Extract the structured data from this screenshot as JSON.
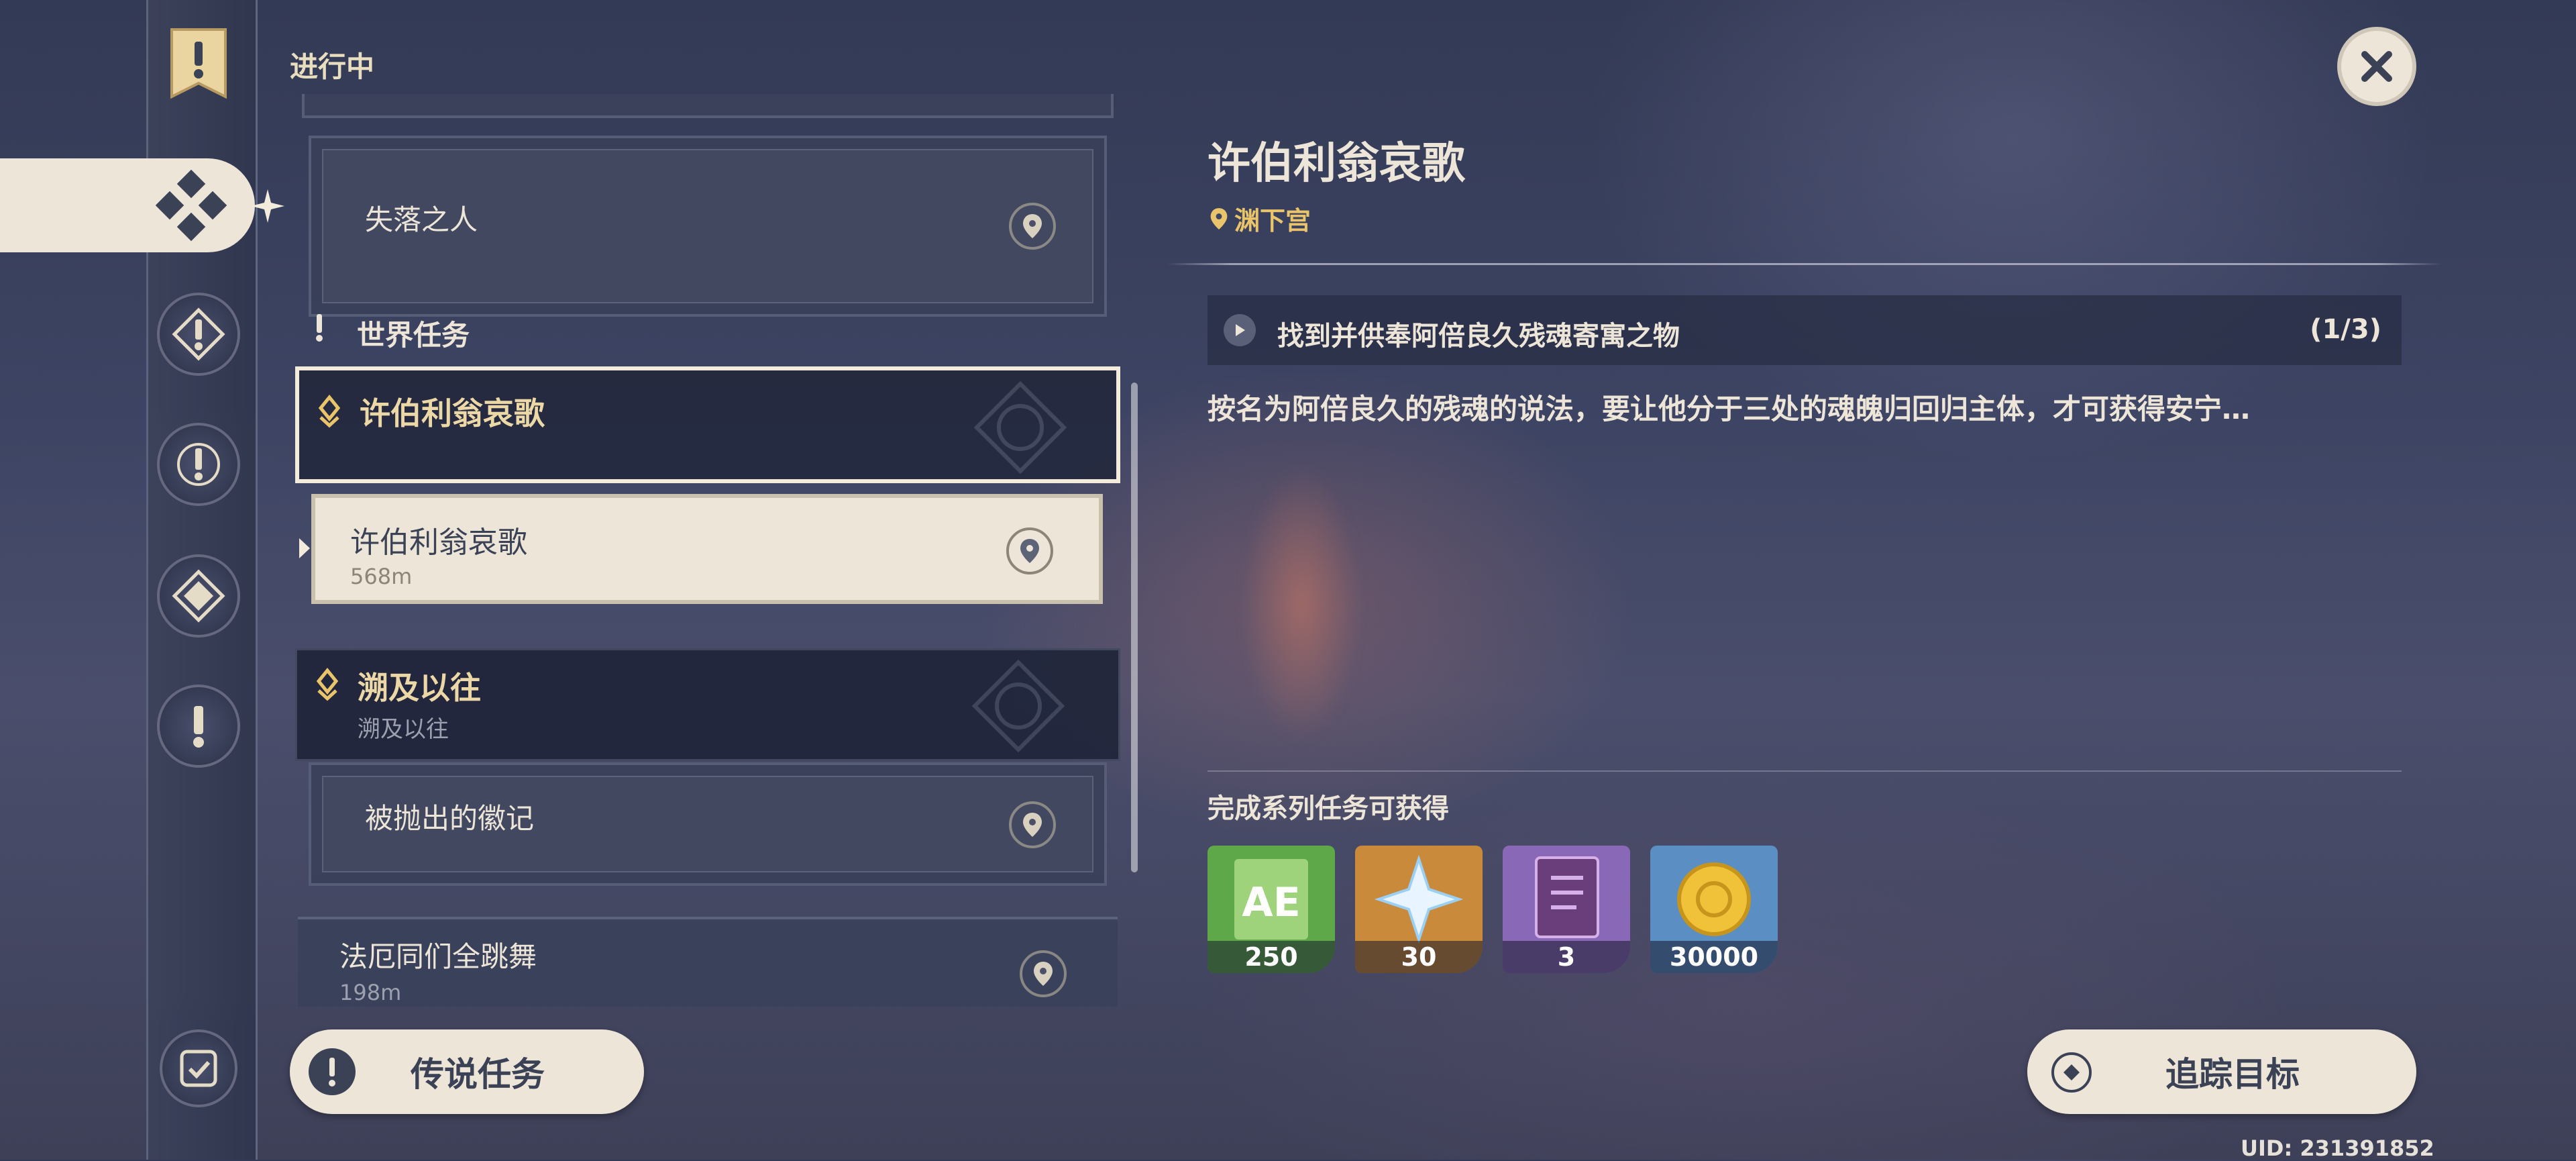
{
  "header": {
    "tab_label": "进行中"
  },
  "rail": {
    "items": [
      {
        "name": "all-quests",
        "active": true
      },
      {
        "name": "archon-quests"
      },
      {
        "name": "story-quests"
      },
      {
        "name": "commissions"
      },
      {
        "name": "world-quests"
      },
      {
        "name": "quest-log-settings"
      }
    ]
  },
  "quest_list": {
    "items": [
      {
        "title": "失落之人"
      },
      {
        "section": "世界任务"
      },
      {
        "series_title": "许伯利翁哀歌",
        "selected": true
      },
      {
        "title": "许伯利翁哀歌",
        "distance": "568m",
        "active": true
      },
      {
        "series_title": "溯及以往",
        "series_subtitle": "溯及以往"
      },
      {
        "title": "被抛出的徽记"
      },
      {
        "title": "法厄同们全跳舞",
        "distance": "198m"
      }
    ]
  },
  "legend_button": {
    "label": "传说任务"
  },
  "detail": {
    "title": "许伯利翁哀歌",
    "location": "渊下宫",
    "objective": {
      "text": "找到并供奉阿倍良久残魂寄寓之物",
      "progress": "(1/3)"
    },
    "description": "按名为阿倍良久的残魂的说法，要让他分于三处的魂魄归回归主体，才可获得安宁…",
    "rewards_label": "完成系列任务可获得",
    "rewards": [
      {
        "icon": "adventure-exp-icon",
        "count": "250",
        "bg": "#5fa84a"
      },
      {
        "icon": "primogem-icon",
        "count": "30",
        "bg": "#c98a3b"
      },
      {
        "icon": "heros-wit-book-icon",
        "count": "3",
        "bg": "#8a68b8"
      },
      {
        "icon": "mora-icon",
        "count": "30000",
        "bg": "#5b8fc4"
      }
    ]
  },
  "track_button": {
    "label": "追踪目标"
  },
  "uid": "UID: 231391852"
}
